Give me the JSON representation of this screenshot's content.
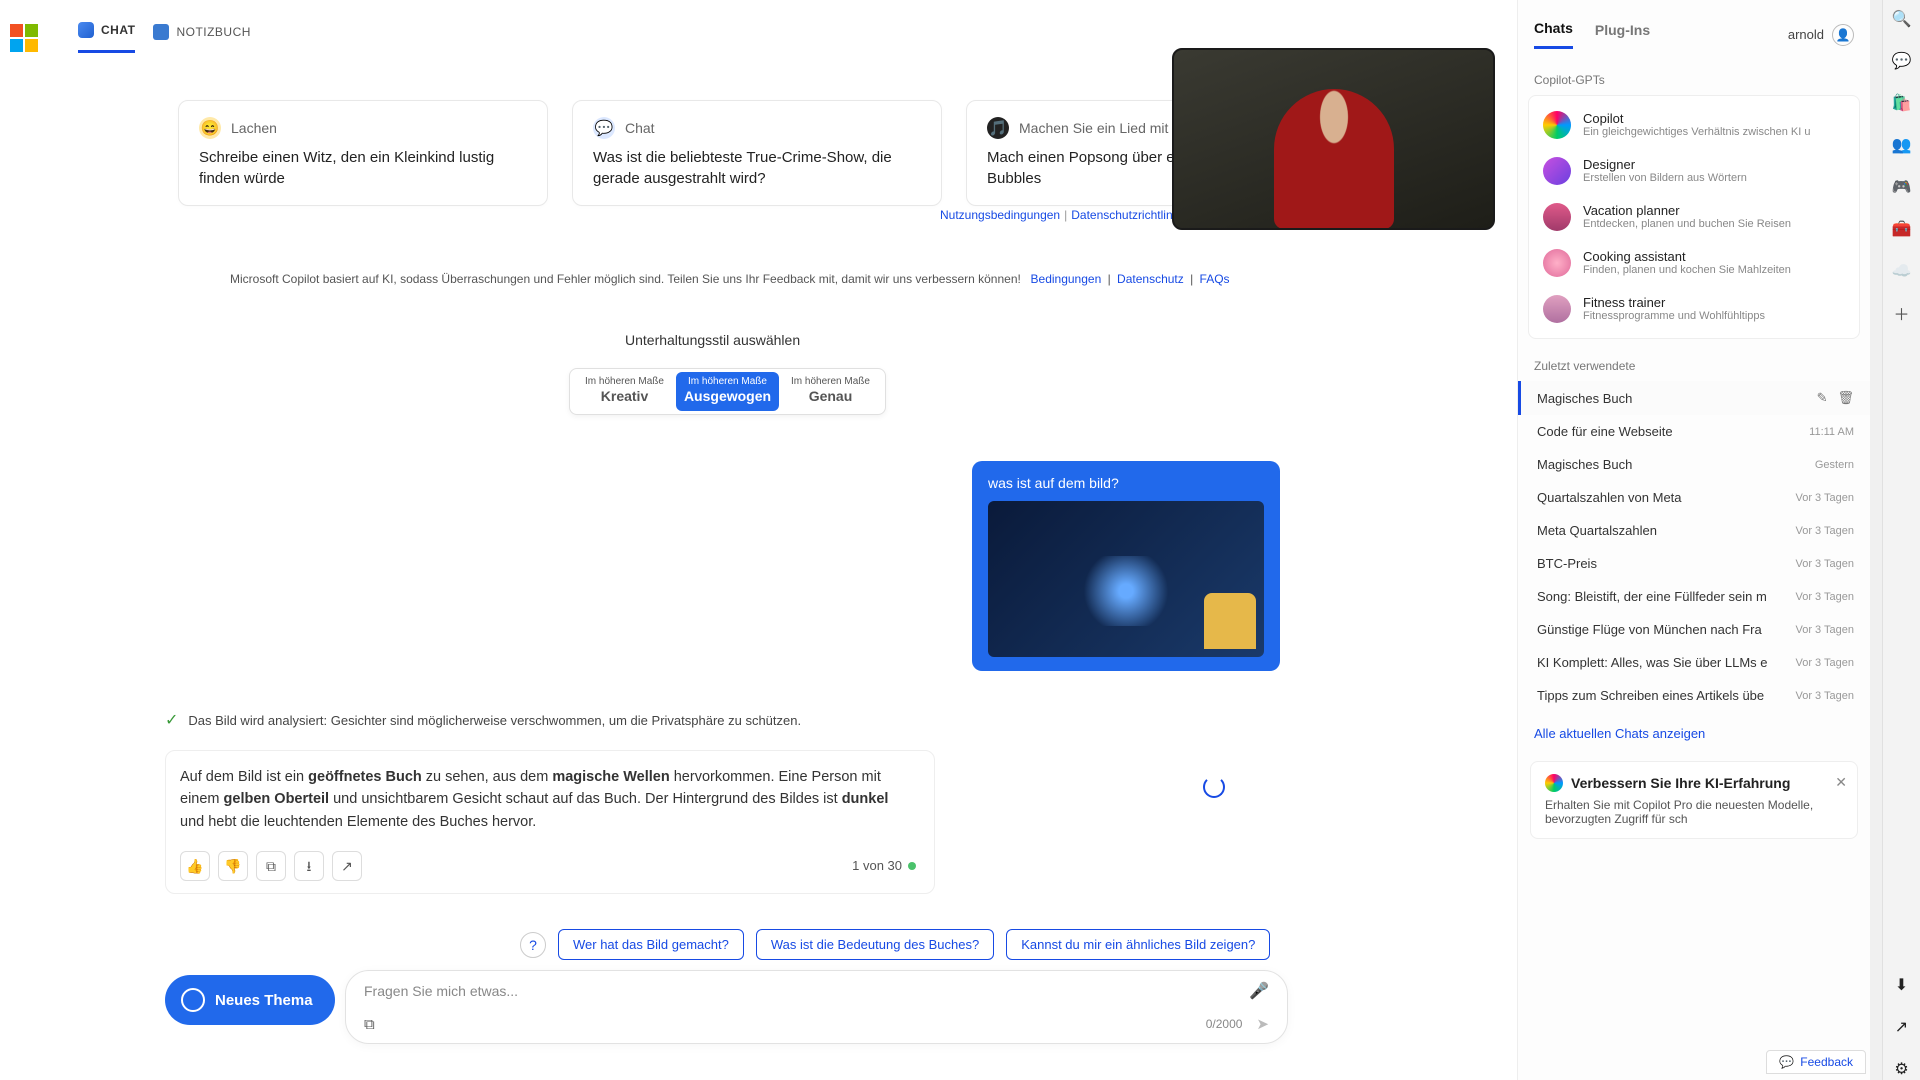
{
  "top_tabs": {
    "chat": "CHAT",
    "notebook": "NOTIZBUCH"
  },
  "cards": [
    {
      "emoji": "😄",
      "head": "Lachen",
      "body": "Schreibe einen Witz, den ein Kleinkind lustig finden würde"
    },
    {
      "emoji": "💬",
      "head": "Chat",
      "body": "Was ist die beliebteste True-Crime-Show, die gerade ausgestrahlt wird?"
    },
    {
      "emoji": "🎵",
      "head": "Machen Sie ein Lied mit Suno",
      "body": "Mach einen Popsong über ein Seepferdchen namens Bubbles"
    }
  ],
  "card_terms": {
    "terms": "Nutzungsbedingungen",
    "privacy": "Datenschutzrichtlinie"
  },
  "disclaimer": {
    "text": "Microsoft Copilot basiert auf KI, sodass Überraschungen und Fehler möglich sind. Teilen Sie uns Ihr Feedback mit, damit wir uns verbessern können!",
    "terms": "Bedingungen",
    "privacy": "Datenschutz",
    "faq": "FAQs"
  },
  "style": {
    "heading": "Unterhaltungsstil auswählen",
    "prefix": "Im höheren Maße",
    "creative": "Kreativ",
    "balanced": "Ausgewogen",
    "precise": "Genau"
  },
  "user_msg": "was ist auf dem bild?",
  "analysis_note": "Das Bild wird analysiert: Gesichter sind möglicherweise verschwommen, um die Privatsphäre zu schützen.",
  "answer": {
    "p1a": "Auf dem Bild ist ein ",
    "p1b": "geöffnetes Buch",
    "p1c": " zu sehen, aus dem ",
    "p1d": "magische Wellen",
    "p1e": " hervorkommen. Eine Person mit einem ",
    "p1f": "gelben Oberteil",
    "p1g": " und unsichtbarem Gesicht schaut auf das Buch. Der Hintergrund des Bildes ist ",
    "p1h": "dunkel",
    "p1i": " und hebt die leuchtenden Elemente des Buches hervor."
  },
  "counter": "1 von 30",
  "followups": {
    "a": "Wer hat das Bild gemacht?",
    "b": "Was ist die Bedeutung des Buches?",
    "c": "Kannst du mir ein ähnliches Bild zeigen?"
  },
  "new_topic": "Neues Thema",
  "input": {
    "placeholder": "Fragen Sie mich etwas...",
    "count": "0/2000"
  },
  "rpanel": {
    "tab_chats": "Chats",
    "tab_plugins": "Plug-Ins",
    "user": "arnold",
    "sub_gpts": "Copilot-GPTs",
    "gpts": [
      {
        "name": "Copilot",
        "desc": "Ein gleichgewichtiges Verhältnis zwischen KI u",
        "color": "conic-gradient(#f06,#09f,#0c6,#fc0,#f06)"
      },
      {
        "name": "Designer",
        "desc": "Erstellen von Bildern aus Wörtern",
        "color": "linear-gradient(135deg,#c850e0,#6a40e0)"
      },
      {
        "name": "Vacation planner",
        "desc": "Entdecken, planen und buchen Sie Reisen",
        "color": "linear-gradient(#e05a8a,#a03a6a)"
      },
      {
        "name": "Cooking assistant",
        "desc": "Finden, planen und kochen Sie Mahlzeiten",
        "color": "radial-gradient(circle,#ffb0c8,#e06a9a)"
      },
      {
        "name": "Fitness trainer",
        "desc": "Fitnessprogramme und Wohlfühltipps",
        "color": "linear-gradient(#e0a0c0,#b070a0)"
      }
    ],
    "recent_head": "Zuletzt verwendete",
    "recent": [
      {
        "title": "Magisches Buch",
        "ts": "",
        "active": true
      },
      {
        "title": "Code für eine Webseite",
        "ts": "11:11 AM"
      },
      {
        "title": "Magisches Buch",
        "ts": "Gestern"
      },
      {
        "title": "Quartalszahlen von Meta",
        "ts": "Vor 3 Tagen"
      },
      {
        "title": "Meta Quartalszahlen",
        "ts": "Vor 3 Tagen"
      },
      {
        "title": "BTC-Preis",
        "ts": "Vor 3 Tagen"
      },
      {
        "title": "Song: Bleistift, der eine Füllfeder sein m",
        "ts": "Vor 3 Tagen"
      },
      {
        "title": "Günstige Flüge von München nach Fra",
        "ts": "Vor 3 Tagen"
      },
      {
        "title": "KI Komplett: Alles, was Sie über LLMs e",
        "ts": "Vor 3 Tagen"
      },
      {
        "title": "Tipps zum Schreiben eines Artikels übe",
        "ts": "Vor 3 Tagen"
      }
    ],
    "show_all": "Alle aktuellen Chats anzeigen",
    "promo_title": "Verbessern Sie Ihre KI-Erfahrung",
    "promo_body": "Erhalten Sie mit Copilot Pro die neuesten Modelle, bevorzugten Zugriff für sch"
  },
  "feedback": "Feedback"
}
